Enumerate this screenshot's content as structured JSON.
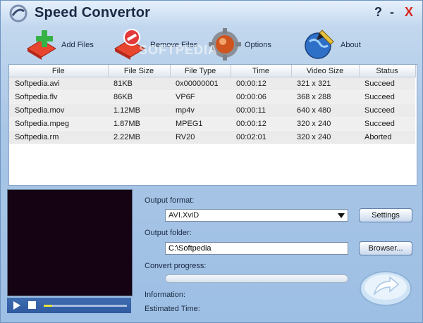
{
  "window": {
    "title": "Speed Convertor",
    "help": "?",
    "minimize": "-",
    "close": "X"
  },
  "toolbar": {
    "add_files": "Add Files",
    "remove_files": "Remove Files",
    "options": "Options",
    "about": "About",
    "watermark": "SOFTPEDIA"
  },
  "table": {
    "columns": [
      "File",
      "File Size",
      "File Type",
      "Time",
      "Video Size",
      "Status"
    ],
    "rows": [
      [
        "Softpedia.avi",
        "81KB",
        "0x00000001",
        "00:00:12",
        "321 x 321",
        "Succeed"
      ],
      [
        "Softpedia.flv",
        "86KB",
        "VP6F",
        "00:00:06",
        "368 x 288",
        "Succeed"
      ],
      [
        "Softpedia.mov",
        "1.12MB",
        "mp4v",
        "00:00:11",
        "640 x 480",
        "Succeed"
      ],
      [
        "Softpedia.mpeg",
        "1.87MB",
        "MPEG1",
        "00:00:12",
        "320 x 240",
        "Succeed"
      ],
      [
        "Softpedia.rm",
        "2.22MB",
        "RV20",
        "00:02:01",
        "320 x 240",
        "Aborted"
      ]
    ]
  },
  "output": {
    "format_label": "Output format:",
    "format_value": "AVI.XviD",
    "settings_button": "Settings",
    "folder_label": "Output folder:",
    "folder_value": "C:\\Softpedia",
    "browse_button": "Browser...",
    "progress_label": "Convert progress:",
    "progress_value": 0,
    "information_label": "Information:",
    "estimated_time_label": "Estimated Time:"
  },
  "player": {
    "seek_position": 0.1
  },
  "colors": {
    "close": "#d8261d",
    "accent": "#2f5aa0",
    "window_bg": "#a9c6e6"
  },
  "icons": [
    "app-logo-icon",
    "add-files-icon",
    "remove-files-icon",
    "options-gear-icon",
    "about-globe-pen-icon",
    "play-icon",
    "stop-icon",
    "convert-arrow-icon"
  ]
}
